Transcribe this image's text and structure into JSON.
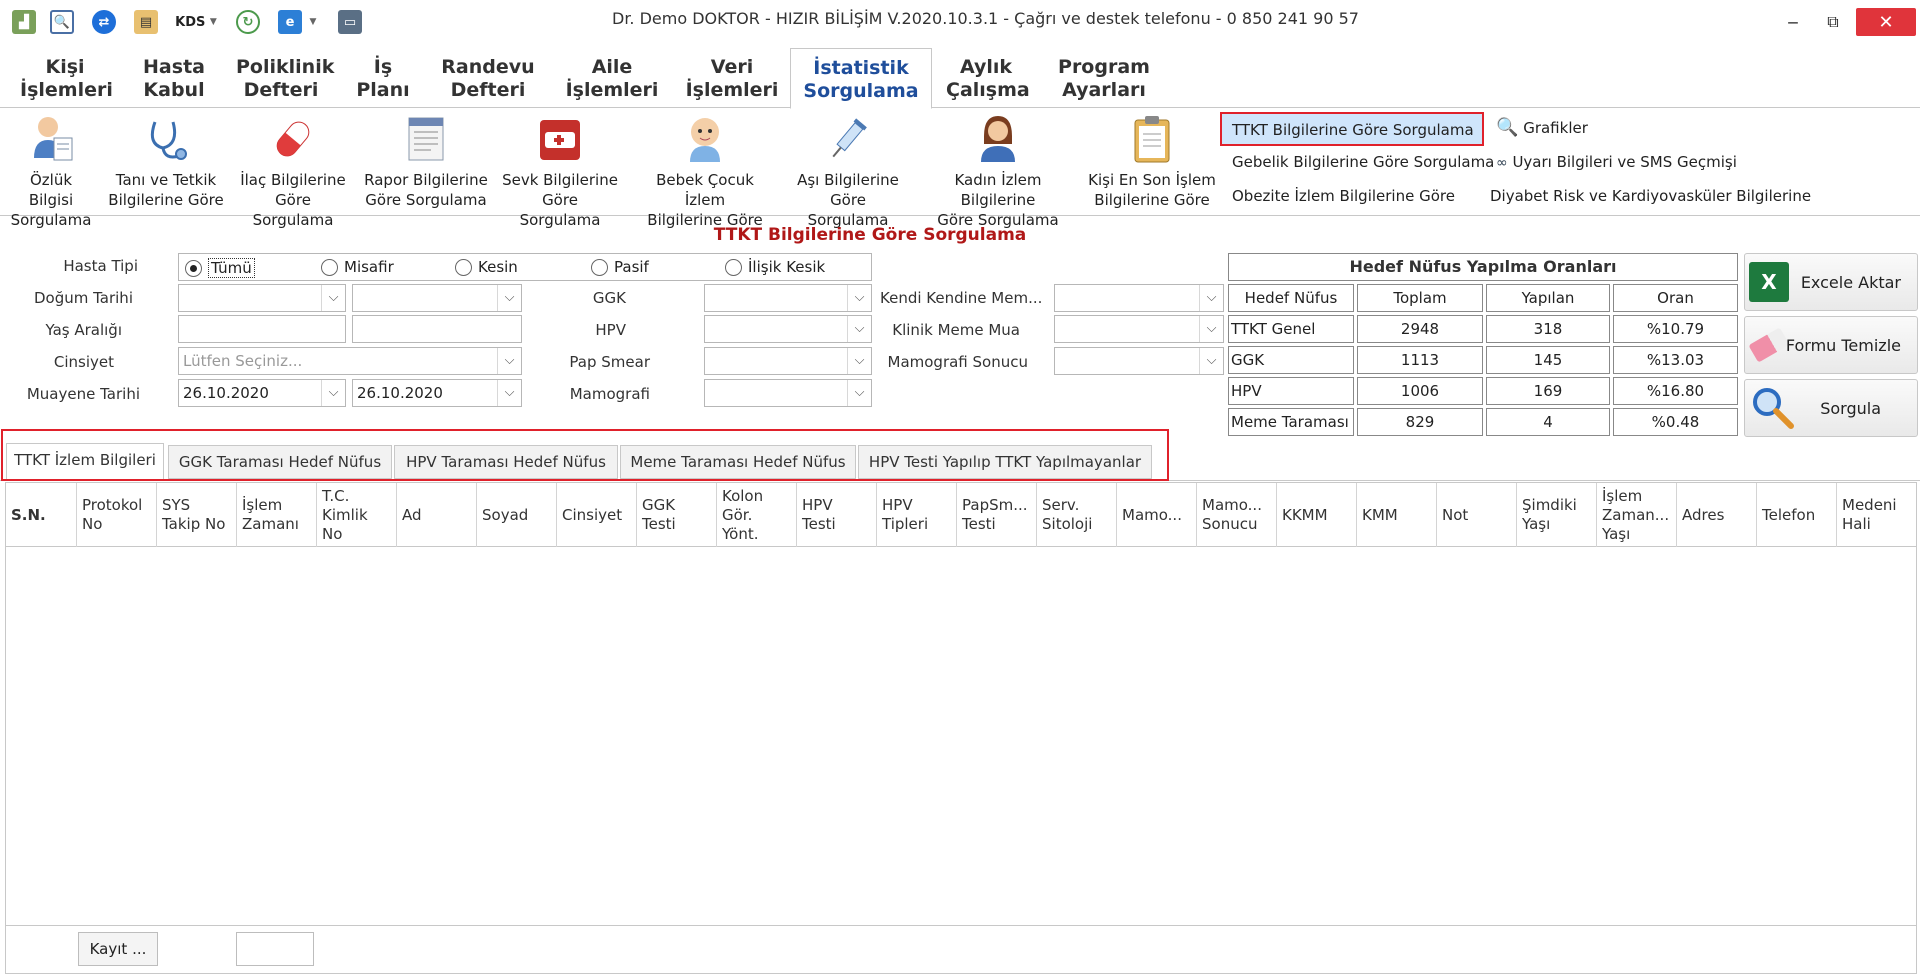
{
  "window": {
    "title": "Dr. Demo DOKTOR - HIZIR BİLİŞİM V.2020.10.3.1 - Çağrı ve destek telefonu - 0 850 241 90 57",
    "kds_label": "KDS"
  },
  "menu": [
    {
      "l1": "Kişi",
      "l2": "İşlemleri"
    },
    {
      "l1": "Hasta",
      "l2": "Kabul"
    },
    {
      "l1": "Poliklinik",
      "l2": "Defteri"
    },
    {
      "l1": "İş",
      "l2": "Planı"
    },
    {
      "l1": "Randevu",
      "l2": "Defteri"
    },
    {
      "l1": "Aile",
      "l2": "İşlemleri"
    },
    {
      "l1": "Veri",
      "l2": "İşlemleri"
    },
    {
      "l1": "İstatistik",
      "l2": "Sorgulama"
    },
    {
      "l1": "Aylık",
      "l2": "Çalışma"
    },
    {
      "l1": "Program",
      "l2": "Ayarları"
    }
  ],
  "ribbon": {
    "buttons": [
      {
        "l1": "Özlük Bilgisi",
        "l2": "Sorgulama"
      },
      {
        "l1": "Tanı ve Tetkik",
        "l2": "Bilgilerine Göre"
      },
      {
        "l1": "İlaç Bilgilerine",
        "l2": "Göre Sorgulama"
      },
      {
        "l1": "Rapor Bilgilerine",
        "l2": "Göre Sorgulama"
      },
      {
        "l1": "Sevk Bilgilerine",
        "l2": "Göre Sorgulama"
      },
      {
        "l1": "Bebek Çocuk İzlem",
        "l2": "Bilgilerine Göre"
      },
      {
        "l1": "Aşı Bilgilerine",
        "l2": "Göre Sorgulama"
      },
      {
        "l1": "Kadın İzlem Bilgilerine",
        "l2": "Göre Sorgulama"
      },
      {
        "l1": "Kişi En Son İşlem",
        "l2": "Bilgilerine Göre"
      }
    ],
    "links_left": [
      "TTKT Bilgilerine Göre Sorgulama",
      "Gebelik Bilgilerine Göre Sorgulama",
      "Obezite İzlem Bilgilerine Göre"
    ],
    "links_right": [
      "Grafikler",
      "Uyarı Bilgileri ve SMS Geçmişi",
      "Diyabet Risk ve Kardiyovasküler Bilgilerine"
    ]
  },
  "form": {
    "title": "TTKT Bilgilerine Göre Sorgulama",
    "labels": {
      "hasta_tipi": "Hasta Tipi",
      "dogum_tarihi": "Doğum Tarihi",
      "yas_araligi": "Yaş Aralığı",
      "cinsiyet": "Cinsiyet",
      "muayene_tarihi": "Muayene Tarihi",
      "ggk": "GGK",
      "hpv": "HPV",
      "pap_smear": "Pap Smear",
      "mamografi": "Mamografi",
      "kendi_kendine": "Kendi Kendine Mem...",
      "klinik_meme": "Klinik Meme Mua",
      "mamografi_sonucu": "Mamografi Sonucu"
    },
    "radios": [
      "Tümü",
      "Misafir",
      "Kesin",
      "Pasif",
      "İlişik Kesik"
    ],
    "cinsiyet_placeholder": "Lütfen Seçiniz...",
    "muayene_start": "26.10.2020",
    "muayene_end": "26.10.2020"
  },
  "stats": {
    "title": "Hedef Nüfus Yapılma Oranları",
    "headers": [
      "Hedef Nüfus",
      "Toplam",
      "Yapılan",
      "Oran"
    ],
    "rows": [
      [
        "TTKT Genel",
        "2948",
        "318",
        "%10.79"
      ],
      [
        "GGK",
        "1113",
        "145",
        "%13.03"
      ],
      [
        "HPV",
        "1006",
        "169",
        "%16.80"
      ],
      [
        "Meme Taraması",
        "829",
        "4",
        "%0.48"
      ]
    ]
  },
  "actions": {
    "excel": "Excele Aktar",
    "clear": "Formu Temizle",
    "query": "Sorgula"
  },
  "result_tabs": [
    "TTKT İzlem Bilgileri",
    "GGK Taraması Hedef Nüfus",
    "HPV Taraması Hedef Nüfus",
    "Meme Taraması Hedef Nüfus",
    "HPV Testi Yapılıp TTKT Yapılmayanlar"
  ],
  "columns": [
    "S.N.",
    "Protokol No",
    "SYS Takip No",
    "İşlem Zamanı",
    "T.C. Kimlik No",
    "Ad",
    "Soyad",
    "Cinsiyet",
    "GGK Testi",
    "Kolon Gör. Yönt.",
    "HPV Testi",
    "HPV Tipleri",
    "PapSm... Testi",
    "Serv. Sitoloji",
    "Mamo...",
    "Mamo... Sonucu",
    "KKMM",
    "KMM",
    "Not",
    "Şimdiki Yaşı",
    "İşlem Zaman... Yaşı",
    "Adres",
    "Telefon",
    "Medeni Hali"
  ],
  "footer": {
    "record_button": "Kayıt ..."
  }
}
